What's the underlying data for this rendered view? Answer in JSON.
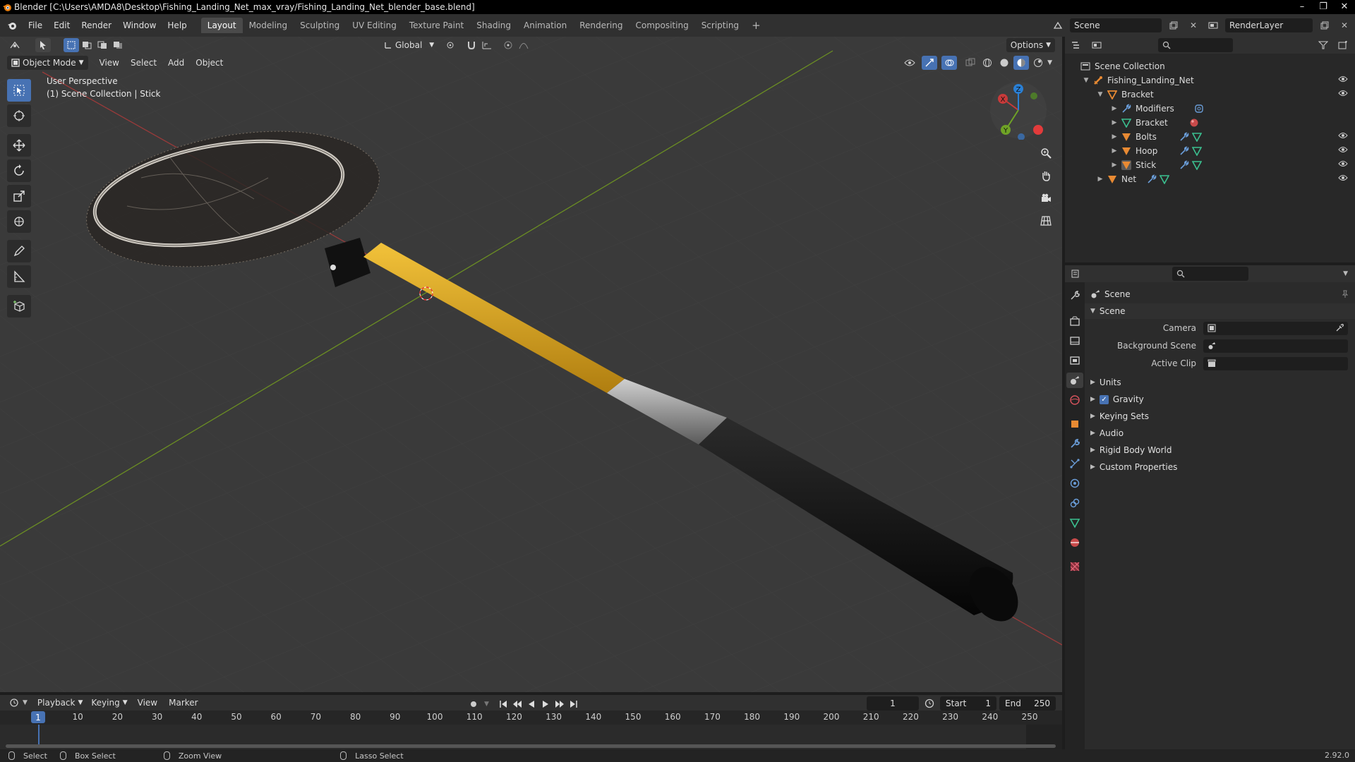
{
  "window": {
    "title": "Blender [C:\\Users\\AMDA8\\Desktop\\Fishing_Landing_Net_max_vray/Fishing_Landing_Net_blender_base.blend]",
    "controls": [
      "–",
      "❐",
      "✕"
    ]
  },
  "menu": [
    "File",
    "Edit",
    "Render",
    "Window",
    "Help"
  ],
  "workspaces": {
    "tabs": [
      "Layout",
      "Modeling",
      "Sculpting",
      "UV Editing",
      "Texture Paint",
      "Shading",
      "Animation",
      "Rendering",
      "Compositing",
      "Scripting"
    ],
    "active": "Layout",
    "add": "+"
  },
  "scene_selector": {
    "value": "Scene"
  },
  "renderlayer_selector": {
    "value": "RenderLayer"
  },
  "viewport": {
    "transform_orientation": "Global",
    "options_label": "Options",
    "mode": "Object Mode",
    "header_menu": [
      "View",
      "Select",
      "Add",
      "Object"
    ],
    "overlay_text_line1": "User Perspective",
    "overlay_text_line2": "(1) Scene Collection | Stick",
    "gizmo": {
      "x": "X",
      "y": "Y",
      "z": "Z"
    }
  },
  "outliner": {
    "root": "Scene Collection",
    "items": [
      {
        "label": "Fishing_Landing_Net",
        "depth": 1,
        "expanded": true
      },
      {
        "label": "Bracket",
        "depth": 2,
        "expanded": true
      },
      {
        "label": "Modifiers",
        "depth": 3,
        "expanded": false
      },
      {
        "label": "Bracket",
        "depth": 3,
        "expanded": false
      },
      {
        "label": "Bolts",
        "depth": 3,
        "expanded": false
      },
      {
        "label": "Hoop",
        "depth": 3,
        "expanded": false
      },
      {
        "label": "Stick",
        "depth": 3,
        "expanded": false
      },
      {
        "label": "Net",
        "depth": 2,
        "expanded": false
      }
    ]
  },
  "properties": {
    "context": "Scene",
    "panel_title": "Scene",
    "fields": [
      {
        "label": "Camera",
        "value": ""
      },
      {
        "label": "Background Scene",
        "value": ""
      },
      {
        "label": "Active Clip",
        "value": ""
      }
    ],
    "panels": [
      "Units",
      "Gravity",
      "Keying Sets",
      "Audio",
      "Rigid Body World",
      "Custom Properties"
    ],
    "gravity_checked": true
  },
  "timeline": {
    "menu": [
      "Playback",
      "Keying",
      "View",
      "Marker"
    ],
    "current_frame": "1",
    "start_label": "Start",
    "start": "1",
    "end_label": "End",
    "end": "250",
    "ruler_ticks": [
      "10",
      "20",
      "30",
      "40",
      "50",
      "60",
      "70",
      "80",
      "90",
      "100",
      "110",
      "120",
      "130",
      "140",
      "150",
      "160",
      "170",
      "180",
      "190",
      "200",
      "210",
      "220",
      "230",
      "240",
      "250"
    ],
    "playhead": "1"
  },
  "statusbar": {
    "items": [
      "Select",
      "Box Select",
      "Zoom View",
      "Lasso Select"
    ],
    "version": "2.92.0"
  },
  "colors": {
    "accent": "#4772b3",
    "x_axis": "#c83a3a",
    "y_axis": "#6fa326",
    "z_axis": "#2a7fd4",
    "handle_yellow": "#e0a820",
    "object_orange": "#e88a33",
    "mesh_green": "#3bbf8f"
  }
}
